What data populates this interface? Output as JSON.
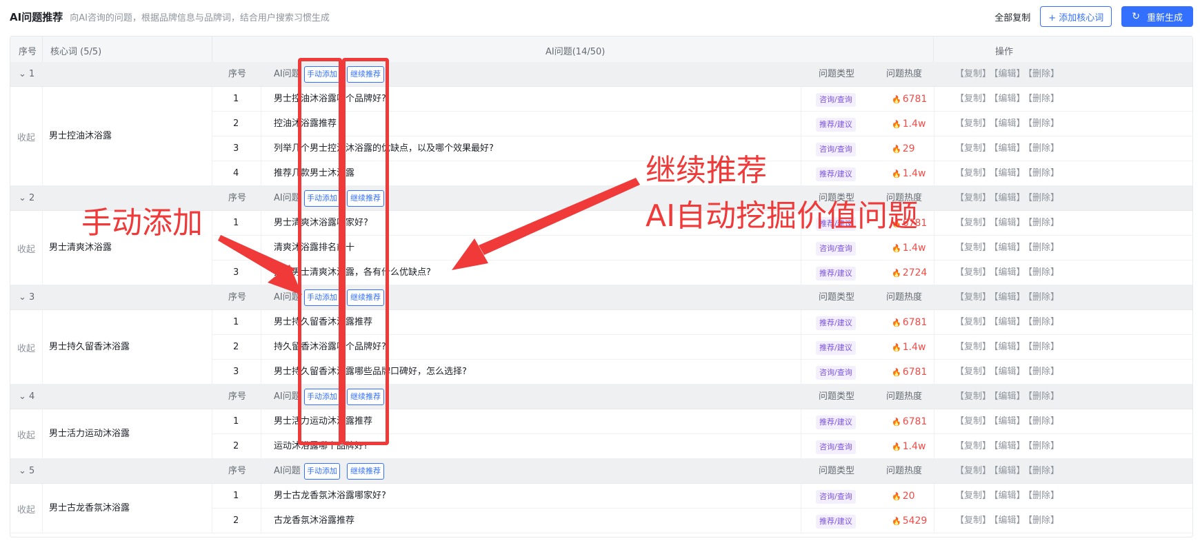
{
  "header": {
    "title": "AI问题推荐",
    "desc": "向AI咨询的问题，根据品牌信息与品牌词，结合用户搜索习惯生成",
    "copy_all": "全部复制",
    "add_keyword": "+ 添加核心词",
    "regenerate": "重新生成",
    "regenerate_icon": "refresh-icon"
  },
  "columns": {
    "index": "序号",
    "keyword": "核心词 (5/5)",
    "questions": "AI问题(14/50)",
    "actions": "操作"
  },
  "sub_columns": {
    "index": "序号",
    "question": "AI问题",
    "manual_add": "手动添加",
    "continue_recommend": "继续推荐",
    "type": "问题类型",
    "heat": "问题热度"
  },
  "actions": {
    "copy": "【复制】",
    "edit": "【编辑】",
    "delete": "【删除】"
  },
  "collapse_label": "收起",
  "groups": [
    {
      "index": "1",
      "keyword": "男士控油沐浴露",
      "rows": [
        {
          "no": "1",
          "q": "男士控油沐浴露哪个品牌好?",
          "type": "咨询/查询",
          "heat": "6781"
        },
        {
          "no": "2",
          "q": "控油沐浴露推荐",
          "type": "推荐/建议",
          "heat": "1.4w"
        },
        {
          "no": "3",
          "q": "列举几个男士控油沐浴露的优缺点，以及哪个效果最好?",
          "type": "咨询/查询",
          "heat": "29"
        },
        {
          "no": "4",
          "q": "推荐几款男士沐浴露",
          "type": "推荐/建议",
          "heat": "1.4w"
        }
      ]
    },
    {
      "index": "2",
      "keyword": "男士清爽沐浴露",
      "rows": [
        {
          "no": "1",
          "q": "男士清爽沐浴露哪家好?",
          "type": "推荐/建议",
          "heat": "6781"
        },
        {
          "no": "2",
          "q": "清爽沐浴露排名前十",
          "type": "咨询/查询",
          "heat": "1.4w"
        },
        {
          "no": "3",
          "q": "推荐男士清爽沐浴露，各有什么优缺点?",
          "type": "推荐/建议",
          "heat": "2724"
        }
      ]
    },
    {
      "index": "3",
      "keyword": "男士持久留香沐浴露",
      "rows": [
        {
          "no": "1",
          "q": "男士持久留香沐浴露推荐",
          "type": "推荐/建议",
          "heat": "6781"
        },
        {
          "no": "2",
          "q": "持久留香沐浴露哪个品牌好?",
          "type": "推荐/建议",
          "heat": "1.4w"
        },
        {
          "no": "3",
          "q": "男士持久留香沐浴露哪些品牌口碑好，怎么选择?",
          "type": "咨询/查询",
          "heat": "6781"
        }
      ]
    },
    {
      "index": "4",
      "keyword": "男士活力运动沐浴露",
      "rows": [
        {
          "no": "1",
          "q": "男士活力运动沐浴露推荐",
          "type": "推荐/建议",
          "heat": "6781"
        },
        {
          "no": "2",
          "q": "运动沐浴露哪个品牌好?",
          "type": "咨询/查询",
          "heat": "1.4w"
        }
      ]
    },
    {
      "index": "5",
      "keyword": "男士古龙香氛沐浴露",
      "rows": [
        {
          "no": "1",
          "q": "男士古龙香氛沐浴露哪家好?",
          "type": "咨询/查询",
          "heat": "20"
        },
        {
          "no": "2",
          "q": "古龙香氛沐浴露推荐",
          "type": "推荐/建议",
          "heat": "5429"
        }
      ]
    }
  ],
  "annotations": {
    "manual": "手动添加",
    "continue_line1": "继续推荐",
    "continue_line2": "AI自动挖掘价值问题"
  },
  "colors": {
    "accent": "#3370ff",
    "highlight": "#f03a3a",
    "heat": "#f54a45",
    "badge": "#7b52e8"
  }
}
